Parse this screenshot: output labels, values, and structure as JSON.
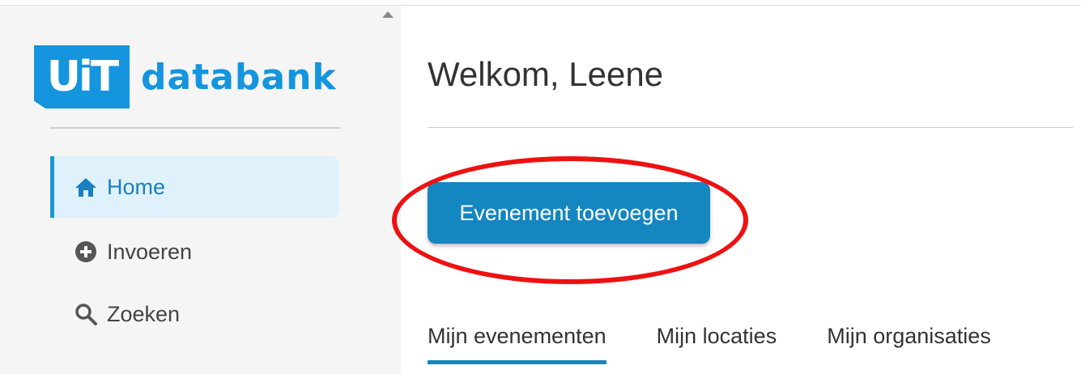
{
  "sidebar": {
    "logo": {
      "badge": "UiT",
      "word": "databank"
    },
    "items": [
      {
        "label": "Home",
        "icon": "home-icon",
        "active": true
      },
      {
        "label": "Invoeren",
        "icon": "plus-circle-icon",
        "active": false
      },
      {
        "label": "Zoeken",
        "icon": "search-icon",
        "active": false
      }
    ]
  },
  "main": {
    "title": "Welkom, Leene",
    "add_event_label": "Evenement toevoegen",
    "tabs": [
      {
        "label": "Mijn evenementen",
        "active": true
      },
      {
        "label": "Mijn locaties",
        "active": false
      },
      {
        "label": "Mijn organisaties",
        "active": false
      }
    ]
  },
  "colors": {
    "brand": "#1495dd",
    "primary_button": "#1486c0",
    "active_nav_bg": "#dff2fb",
    "annotation": "#ee1111"
  }
}
